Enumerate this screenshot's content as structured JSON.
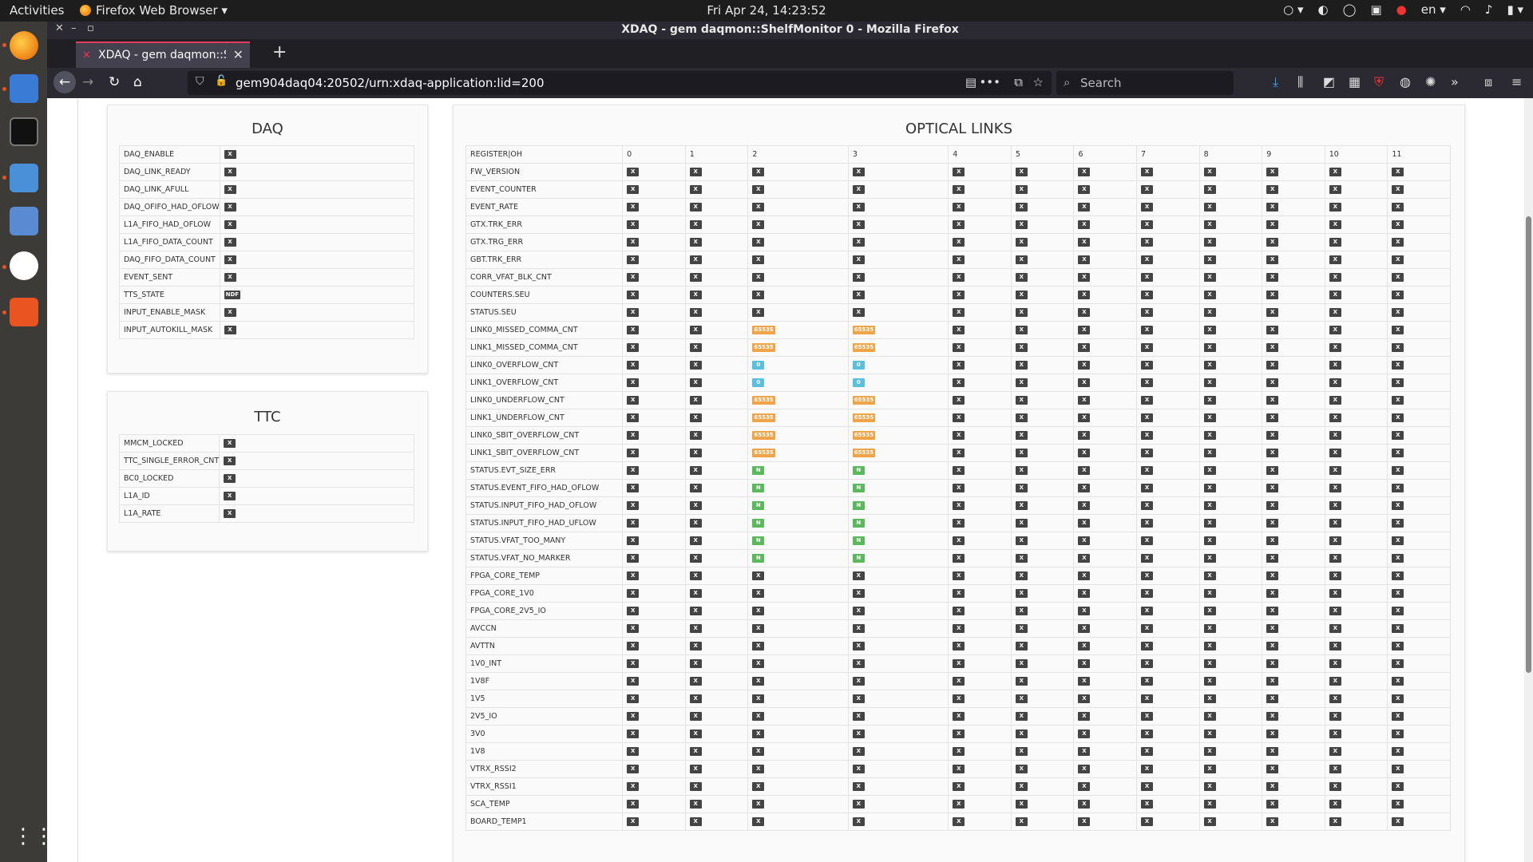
{
  "system_bar": {
    "activities": "Activities",
    "app_name": "Firefox Web Browser ▾",
    "clock": "Fri Apr 24, 14:23:52",
    "lang": "en ▾"
  },
  "window": {
    "title": "XDAQ - gem daqmon::ShelfMonitor 0 - Mozilla Firefox"
  },
  "tab": {
    "label": "XDAQ - gem daqmon::Sh",
    "close": "✕",
    "new_tab": "+"
  },
  "url": {
    "address": "gem904daq04:20502/urn:xdaq-application:lid=200",
    "search_placeholder": "Search"
  },
  "colors": {
    "warn": "#f0a44a",
    "info": "#5bc0de",
    "ok": "#5cb85c",
    "default": "#444444"
  },
  "daq": {
    "title": "DAQ",
    "rows": [
      {
        "name": "DAQ_ENABLE",
        "value": "X",
        "style": "def"
      },
      {
        "name": "DAQ_LINK_READY",
        "value": "X",
        "style": "def"
      },
      {
        "name": "DAQ_LINK_AFULL",
        "value": "X",
        "style": "def"
      },
      {
        "name": "DAQ_OFIFO_HAD_OFLOW",
        "value": "X",
        "style": "def"
      },
      {
        "name": "L1A_FIFO_HAD_OFLOW",
        "value": "X",
        "style": "def"
      },
      {
        "name": "L1A_FIFO_DATA_COUNT",
        "value": "X",
        "style": "def"
      },
      {
        "name": "DAQ_FIFO_DATA_COUNT",
        "value": "X",
        "style": "def"
      },
      {
        "name": "EVENT_SENT",
        "value": "X",
        "style": "def"
      },
      {
        "name": "TTS_STATE",
        "value": "NDF",
        "style": "def"
      },
      {
        "name": "INPUT_ENABLE_MASK",
        "value": "X",
        "style": "def"
      },
      {
        "name": "INPUT_AUTOKILL_MASK",
        "value": "X",
        "style": "def"
      }
    ]
  },
  "ttc": {
    "title": "TTC",
    "rows": [
      {
        "name": "MMCM_LOCKED",
        "value": "X",
        "style": "def"
      },
      {
        "name": "TTC_SINGLE_ERROR_CNT",
        "value": "X",
        "style": "def"
      },
      {
        "name": "BC0_LOCKED",
        "value": "X",
        "style": "def"
      },
      {
        "name": "L1A_ID",
        "value": "X",
        "style": "def"
      },
      {
        "name": "L1A_RATE",
        "value": "X",
        "style": "def"
      }
    ]
  },
  "optical": {
    "title": "OPTICAL LINKS",
    "header": [
      "REGISTER|OH",
      "0",
      "1",
      "2",
      "3",
      "4",
      "5",
      "6",
      "7",
      "8",
      "9",
      "10",
      "11"
    ],
    "rows": [
      {
        "name": "FW_VERSION"
      },
      {
        "name": "EVENT_COUNTER"
      },
      {
        "name": "EVENT_RATE"
      },
      {
        "name": "GTX.TRK_ERR"
      },
      {
        "name": "GTX.TRG_ERR"
      },
      {
        "name": "GBT.TRK_ERR"
      },
      {
        "name": "CORR_VFAT_BLK_CNT"
      },
      {
        "name": "COUNTERS.SEU"
      },
      {
        "name": "STATUS.SEU"
      },
      {
        "name": "LINK0_MISSED_COMMA_CNT",
        "special": {
          "value": "65535",
          "style": "warn"
        }
      },
      {
        "name": "LINK1_MISSED_COMMA_CNT",
        "special": {
          "value": "65535",
          "style": "warn"
        }
      },
      {
        "name": "LINK0_OVERFLOW_CNT",
        "special": {
          "value": "0",
          "style": "info"
        }
      },
      {
        "name": "LINK1_OVERFLOW_CNT",
        "special": {
          "value": "0",
          "style": "info"
        }
      },
      {
        "name": "LINK0_UNDERFLOW_CNT",
        "special": {
          "value": "65535",
          "style": "warn"
        }
      },
      {
        "name": "LINK1_UNDERFLOW_CNT",
        "special": {
          "value": "65535",
          "style": "warn"
        }
      },
      {
        "name": "LINK0_SBIT_OVERFLOW_CNT",
        "special": {
          "value": "65535",
          "style": "warn"
        }
      },
      {
        "name": "LINK1_SBIT_OVERFLOW_CNT",
        "special": {
          "value": "65535",
          "style": "warn"
        }
      },
      {
        "name": "STATUS.EVT_SIZE_ERR",
        "special": {
          "value": "N",
          "style": "ok"
        }
      },
      {
        "name": "STATUS.EVENT_FIFO_HAD_OFLOW",
        "special": {
          "value": "N",
          "style": "ok"
        }
      },
      {
        "name": "STATUS.INPUT_FIFO_HAD_OFLOW",
        "special": {
          "value": "N",
          "style": "ok"
        }
      },
      {
        "name": "STATUS.INPUT_FIFO_HAD_UFLOW",
        "special": {
          "value": "N",
          "style": "ok"
        }
      },
      {
        "name": "STATUS.VFAT_TOO_MANY",
        "special": {
          "value": "N",
          "style": "ok"
        }
      },
      {
        "name": "STATUS.VFAT_NO_MARKER",
        "special": {
          "value": "N",
          "style": "ok"
        }
      },
      {
        "name": "FPGA_CORE_TEMP"
      },
      {
        "name": "FPGA_CORE_1V0"
      },
      {
        "name": "FPGA_CORE_2V5_IO"
      },
      {
        "name": "AVCCN"
      },
      {
        "name": "AVTTN"
      },
      {
        "name": "1V0_INT"
      },
      {
        "name": "1V8F"
      },
      {
        "name": "1V5"
      },
      {
        "name": "2V5_IO"
      },
      {
        "name": "3V0"
      },
      {
        "name": "1V8"
      },
      {
        "name": "VTRX_RSSI2"
      },
      {
        "name": "VTRX_RSSI1"
      },
      {
        "name": "SCA_TEMP"
      },
      {
        "name": "BOARD_TEMP1"
      }
    ],
    "special_columns": [
      2,
      3
    ],
    "default_value": "X"
  }
}
